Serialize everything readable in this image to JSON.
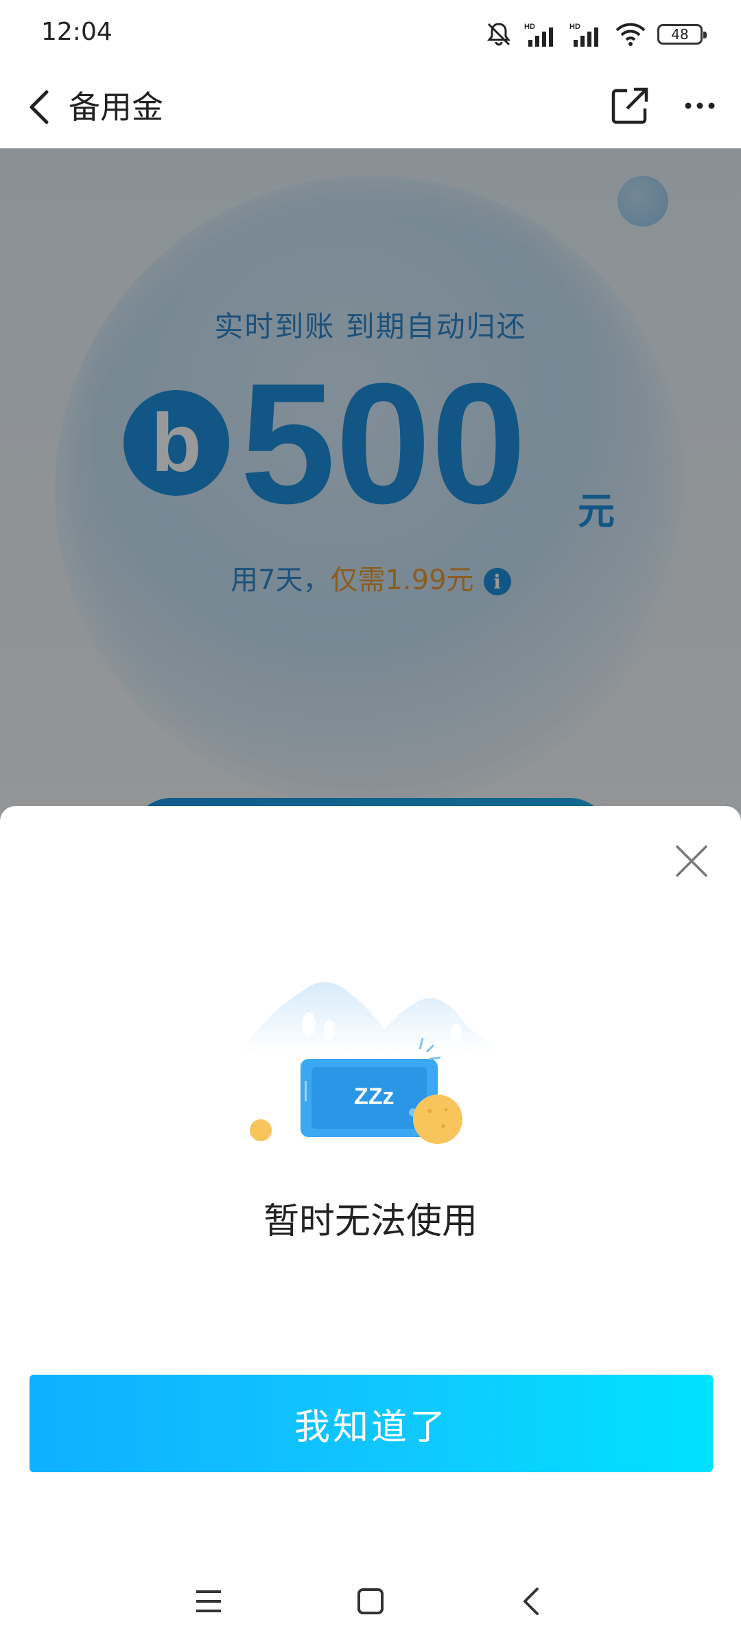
{
  "status_bar": {
    "time": "12:04",
    "battery": "48",
    "icons": [
      "mute-icon",
      "hd-signal-icon",
      "hd-signal-icon",
      "wifi-icon",
      "battery-icon"
    ]
  },
  "header": {
    "title": "备用金",
    "icons": [
      "back-icon",
      "share-icon",
      "more-icon"
    ]
  },
  "promo": {
    "tagline": "实时到账 到期自动归还",
    "logo_letter": "b",
    "amount": "500",
    "unit": "元",
    "desc_days": "用7天，",
    "desc_price": "仅需1.99元",
    "info_symbol": "i"
  },
  "sheet": {
    "illustration_text": "ZZz",
    "message": "暂时无法使用",
    "button_label": "我知道了"
  },
  "nav_bar": {
    "icons": [
      "menu-icon",
      "home-icon",
      "back-icon"
    ]
  },
  "colors": {
    "accent": "#1d8fdc",
    "price": "#e89a36",
    "button_start": "#0fb0ff",
    "button_end": "#00e2ff"
  }
}
